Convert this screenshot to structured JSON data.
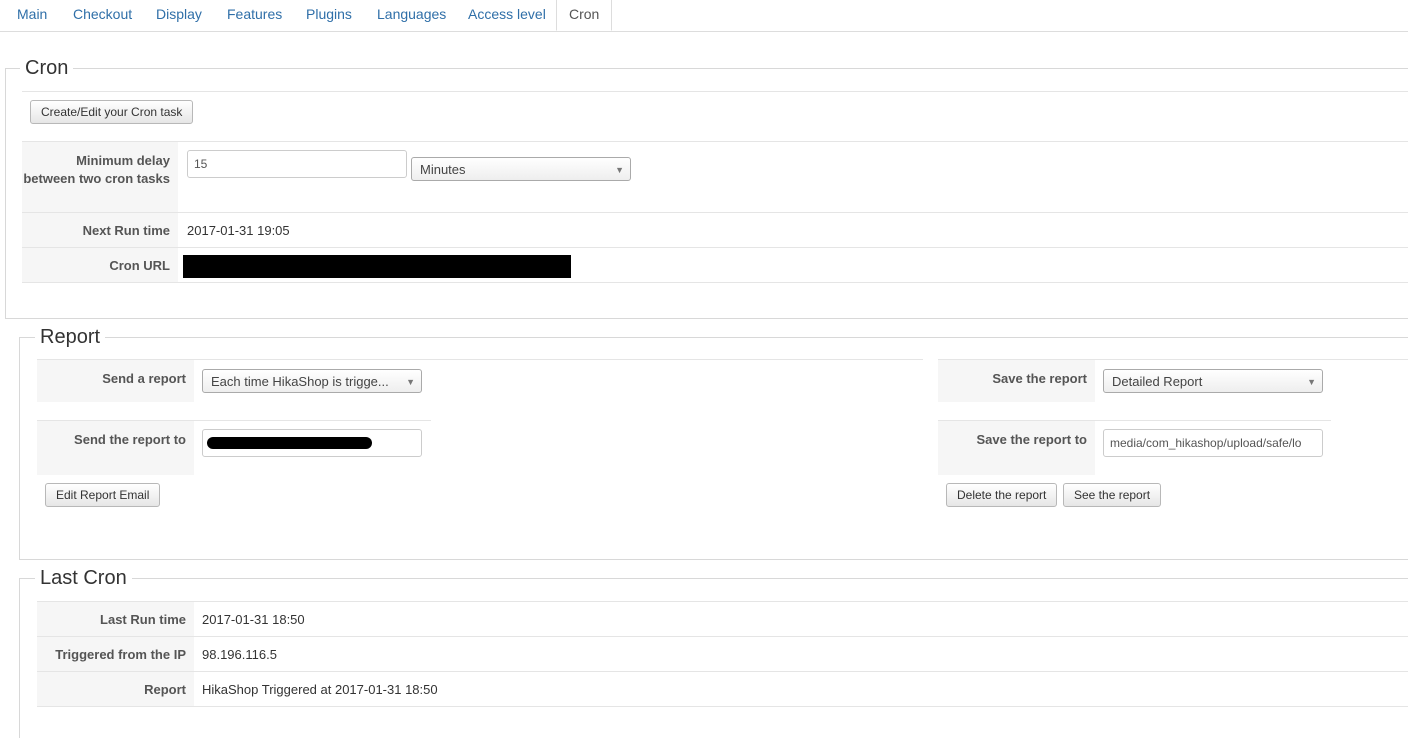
{
  "tabs": [
    "Main",
    "Checkout",
    "Display",
    "Features",
    "Plugins",
    "Languages",
    "Access level",
    "Cron"
  ],
  "active_tab": "Cron",
  "cron": {
    "legend": "Cron",
    "create_button": "Create/Edit your Cron task",
    "min_delay_label": "Minimum delay between two cron tasks",
    "min_delay_value": "15",
    "min_delay_unit": "Minutes",
    "next_run_label": "Next Run time",
    "next_run_value": "2017-01-31 19:05",
    "cron_url_label": "Cron URL"
  },
  "report": {
    "legend": "Report",
    "send_label": "Send a report",
    "send_value": "Each time HikaShop is trigge...",
    "send_to_label": "Send the report to",
    "edit_email_button": "Edit Report Email",
    "save_label": "Save the report",
    "save_value": "Detailed Report",
    "save_to_label": "Save the report to",
    "save_to_value": "media/com_hikashop/upload/safe/lo",
    "delete_button": "Delete the report",
    "see_button": "See the report"
  },
  "last_cron": {
    "legend": "Last Cron",
    "last_run_label": "Last Run time",
    "last_run_value": "2017-01-31 18:50",
    "ip_label": "Triggered from the IP",
    "ip_value": "98.196.116.5",
    "report_label": "Report",
    "report_value": "HikaShop Triggered at 2017-01-31 18:50"
  }
}
